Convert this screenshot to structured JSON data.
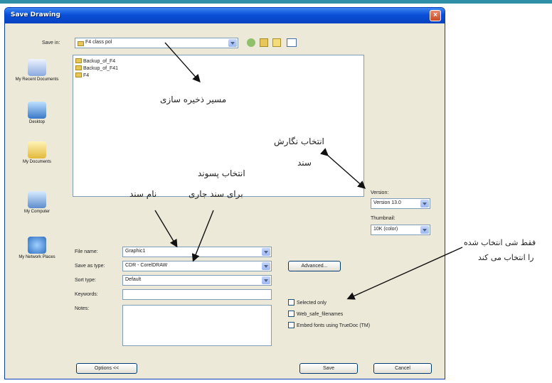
{
  "dialog": {
    "title": "Save Drawing",
    "close_glyph": "×",
    "save_in_label": "Save in:",
    "save_in_value": "F4 class pol",
    "file_name_label": "File name:",
    "file_name_value": "Graphic1",
    "save_as_type_label": "Save as type:",
    "save_as_type_value": "CDR - CorelDRAW",
    "sort_type_label": "Sort type:",
    "sort_type_value": "Default",
    "keywords_label": "Keywords:",
    "notes_label": "Notes:",
    "version_label": "Version:",
    "version_value": "Version 13.0",
    "thumbnail_label": "Thumbnail:",
    "thumbnail_value": "10K (color)",
    "advanced_button": "Advanced...",
    "options_button": "Options <<",
    "save_button": "Save",
    "cancel_button": "Cancel",
    "checkboxes": [
      "Selected only",
      "Web_safe_filenames",
      "Embed fonts using TrueDoc (TM)"
    ],
    "places": [
      "My Recent Documents",
      "Desktop",
      "My Documents",
      "My Computer",
      "My Network Places"
    ],
    "files": [
      "Backup_of_F4",
      "Backup_of_F41",
      "F4"
    ]
  },
  "annotations": {
    "save_path": "مسیر ذخیره سازی",
    "doc_version_1": "انتخاب نگارش",
    "doc_version_2": "سند",
    "extension_1": "انتخاب پسوند",
    "extension_2": "برای سند جاری",
    "doc_name": "نام سند",
    "selection_1": "فقط شی انتخاب شده",
    "selection_2": "را انتخاب می کند"
  },
  "colors": {
    "titlebar": "#0a4fd8",
    "dialog_bg": "#ece9d8",
    "frame": "#0a3fb8"
  },
  "icons": [
    "close-icon",
    "folder-icon",
    "back-icon",
    "up-folder-icon",
    "new-folder-icon",
    "views-icon"
  ]
}
